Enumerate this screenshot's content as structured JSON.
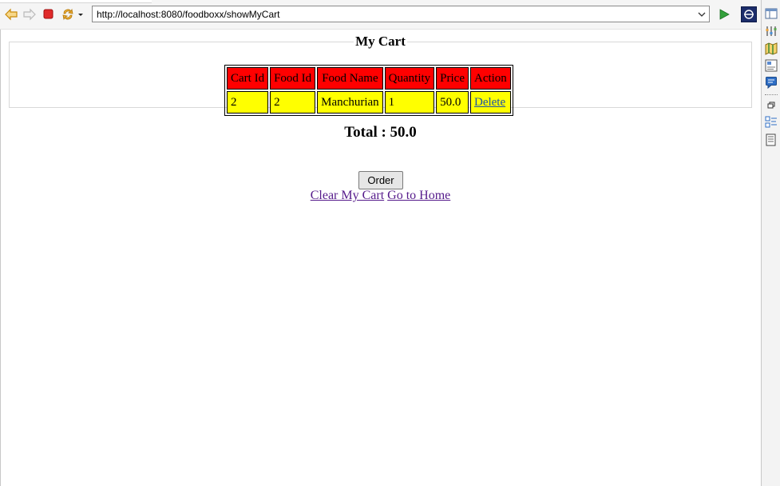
{
  "browser": {
    "url": "http://localhost:8080/foodboxx/showMyCart"
  },
  "page": {
    "legend": "My Cart",
    "table": {
      "headers": [
        "Cart Id",
        "Food Id",
        "Food Name",
        "Quantity",
        "Price",
        "Action"
      ],
      "rows": [
        {
          "cart_id": "2",
          "food_id": "2",
          "food_name": "Manchurian",
          "quantity": "1",
          "price": "50.0",
          "action": "Delete"
        }
      ]
    },
    "total": "Total : 50.0",
    "order_button": "Order",
    "clear_cart_link": "Clear My Cart",
    "home_link": "Go to Home"
  },
  "colors": {
    "header_bg": "#ff0000",
    "cell_bg": "#ffff00",
    "visited_link": "#551a8b",
    "link": "#1a52a8"
  }
}
